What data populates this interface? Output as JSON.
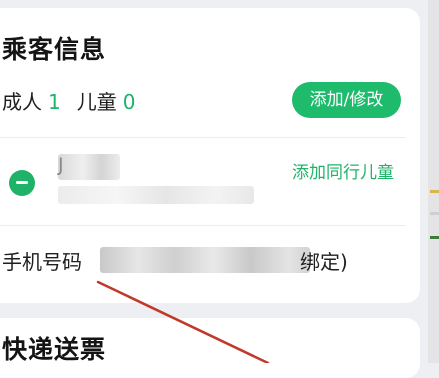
{
  "passenger_section": {
    "title": "乘客信息",
    "adult_label": "成人",
    "adult_count": "1",
    "child_label": "儿童",
    "child_count": "0",
    "edit_button": "添加/修改",
    "passenger_name_visible": "J",
    "add_child_link": "添加同行儿童",
    "phone_label": "手机号码",
    "phone_suffix": "绑定)"
  },
  "delivery_section": {
    "title": "快递送票"
  },
  "colors": {
    "accent": "#1fbb6c",
    "annotation_arrow": "#c0392b"
  },
  "icons": {
    "remove_passenger": "minus-circle-icon"
  }
}
